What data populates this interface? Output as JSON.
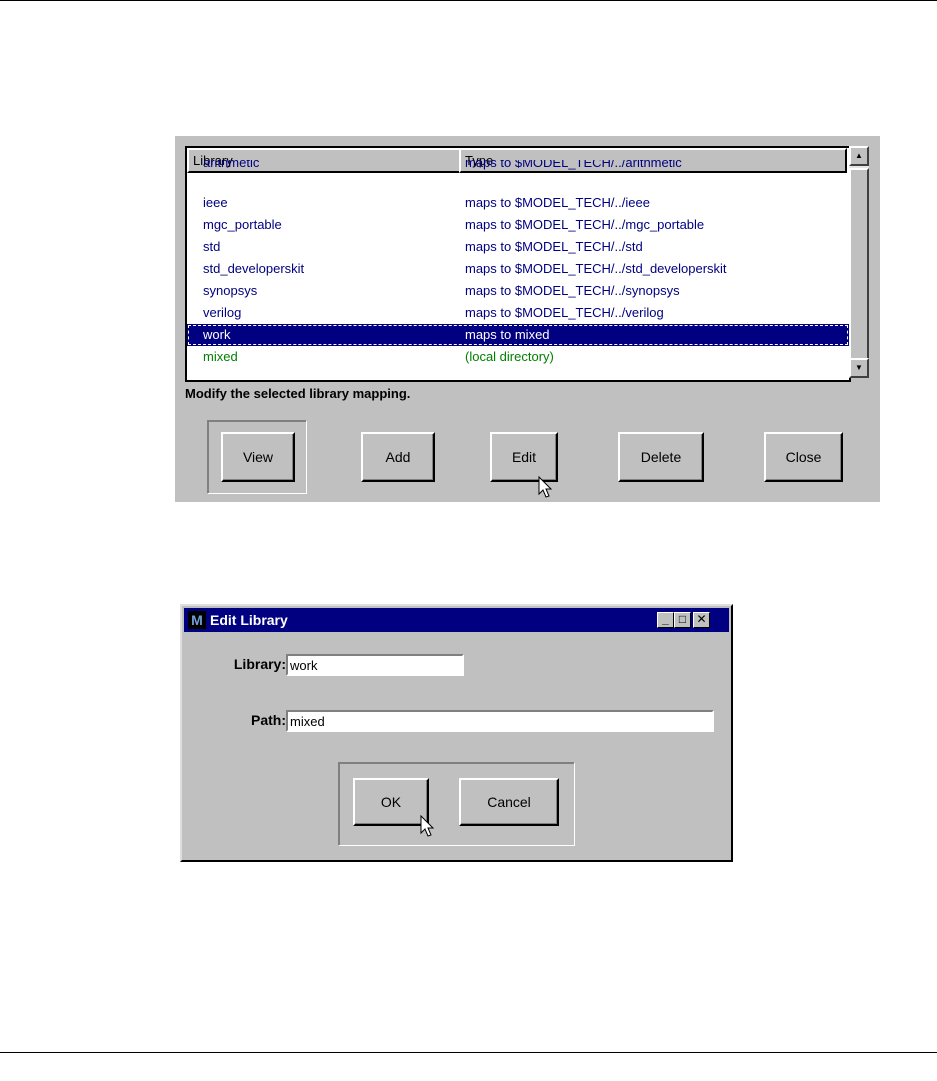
{
  "library_browser": {
    "columns": {
      "library": "Library",
      "type": "Type"
    },
    "partial_row": {
      "library": "arithmetic",
      "type": "maps to $MODEL_TECH/../arithmetic"
    },
    "rows": [
      {
        "library": "ieee",
        "type": "maps to $MODEL_TECH/../ieee"
      },
      {
        "library": "mgc_portable",
        "type": "maps to $MODEL_TECH/../mgc_portable"
      },
      {
        "library": "std",
        "type": "maps to $MODEL_TECH/../std"
      },
      {
        "library": "std_developerskit",
        "type": "maps to $MODEL_TECH/../std_developerskit"
      },
      {
        "library": "synopsys",
        "type": "maps to $MODEL_TECH/../synopsys"
      },
      {
        "library": "verilog",
        "type": "maps to $MODEL_TECH/../verilog"
      },
      {
        "library": "work",
        "type": "maps to mixed"
      },
      {
        "library": "mixed",
        "type": "(local directory)"
      }
    ],
    "selected_library": "work",
    "status_text": "Modify the selected library mapping.",
    "buttons": {
      "view": "View",
      "add": "Add",
      "edit": "Edit",
      "delete": "Delete",
      "close": "Close"
    },
    "colors": {
      "library_text": "#000080",
      "local_text": "#008000",
      "selection": "#000080"
    }
  },
  "edit_dialog": {
    "title": "Edit Library",
    "app_icon": "modelsim-icon",
    "library_label": "Library:",
    "library_value": "work",
    "path_label": "Path:",
    "path_value": "mixed",
    "ok_label": "OK",
    "cancel_label": "Cancel",
    "title_buttons": {
      "minimize": "_",
      "maximize": "□",
      "close": "✕"
    }
  }
}
